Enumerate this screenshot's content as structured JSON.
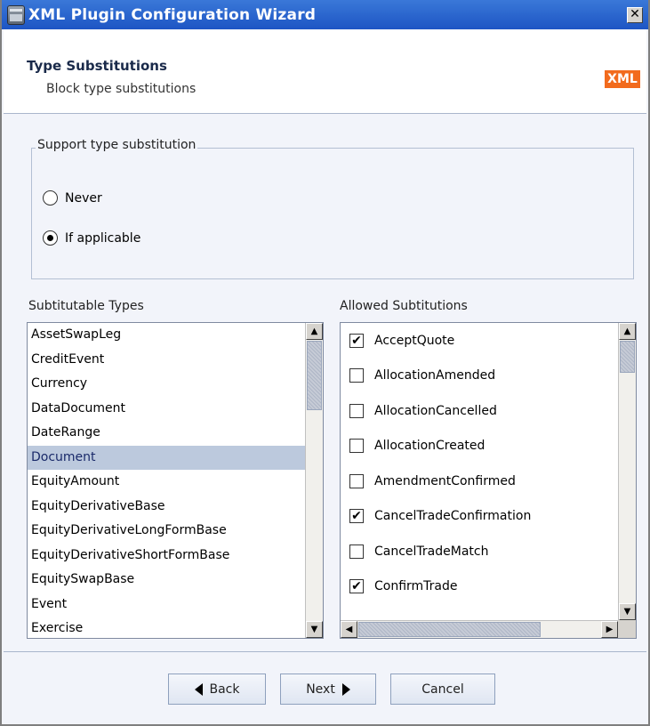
{
  "window": {
    "title": "XML Plugin Configuration Wizard",
    "close_symbol": "✕"
  },
  "header": {
    "title": "Type Substitutions",
    "subtitle": "Block type substitutions",
    "badge": "XML"
  },
  "support_group": {
    "legend": "Support type substitution",
    "options": [
      {
        "label": "Never",
        "selected": false
      },
      {
        "label": "If applicable",
        "selected": true
      }
    ]
  },
  "substitutable": {
    "label": "Subtitutable Types",
    "selected_index": 5,
    "items": [
      "AssetSwapLeg",
      "CreditEvent",
      "Currency",
      "DataDocument",
      "DateRange",
      "Document",
      "EquityAmount",
      "EquityDerivativeBase",
      "EquityDerivativeLongFormBase",
      "EquityDerivativeShortFormBase",
      "EquitySwapBase",
      "Event",
      "Exercise"
    ]
  },
  "allowed": {
    "label": "Allowed Subtitutions",
    "items": [
      {
        "label": "AcceptQuote",
        "checked": true
      },
      {
        "label": "AllocationAmended",
        "checked": false
      },
      {
        "label": "AllocationCancelled",
        "checked": false
      },
      {
        "label": "AllocationCreated",
        "checked": false
      },
      {
        "label": "AmendmentConfirmed",
        "checked": false
      },
      {
        "label": "CancelTradeConfirmation",
        "checked": true
      },
      {
        "label": "CancelTradeMatch",
        "checked": false
      },
      {
        "label": "ConfirmTrade",
        "checked": true
      }
    ]
  },
  "buttons": {
    "back": "Back",
    "next": "Next",
    "cancel": "Cancel"
  },
  "colors": {
    "titlebar": "#1d55c4",
    "badge": "#f26b1d",
    "selection": "#bcc9dd",
    "panel": "#f2f4fa"
  }
}
